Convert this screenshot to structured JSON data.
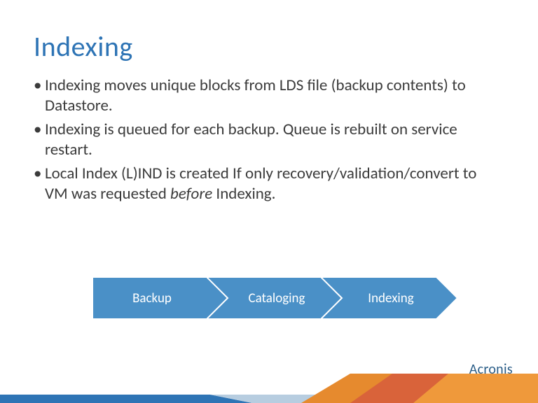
{
  "title": "Indexing",
  "bullets": [
    {
      "text": "Indexing moves unique blocks from LDS file (backup contents) to Datastore."
    },
    {
      "text": "Indexing is queued for each backup. Queue is rebuilt on service restart."
    },
    {
      "prefix": "Local Index (L)IND is created If only recovery/validation/convert to VM was requested ",
      "em": "before",
      "suffix": " Indexing."
    }
  ],
  "process": {
    "steps": [
      "Backup",
      "Cataloging",
      "Indexing"
    ],
    "colors": {
      "fill": "#4a90c7",
      "stroke": "#ffffff"
    }
  },
  "brand": "Acronis"
}
